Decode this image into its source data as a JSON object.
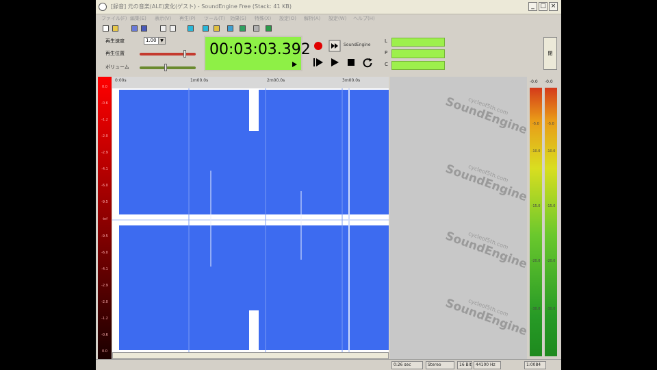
{
  "window": {
    "title": "[録音] 元の音楽(ALE)変化(ゲスト) - SoundEngine Free (Stack: 41 KB)",
    "controls": [
      "_",
      "□",
      "×"
    ]
  },
  "menu": [
    "ファイル(F)",
    "編集(E)",
    "表示(V)",
    "再生(P)",
    "ツール(T)",
    "効果(S)",
    "特殊(X)",
    "設定(O)",
    "解析(A)",
    "設定(W)",
    "ヘルプ(H)"
  ],
  "controls_panel": {
    "speed_label": "再生速度",
    "speed_value": "1.00",
    "position_label": "再生位置",
    "volume_label": "ボリューム"
  },
  "time_display": "00:03:03.392",
  "transport": {
    "brand": "SoundEngine",
    "buttons": [
      "record",
      "record-next",
      "play-selection",
      "play",
      "stop",
      "loop"
    ]
  },
  "mini_labels": [
    "L",
    "P",
    "C"
  ],
  "mini_button": "閉",
  "db_scale": [
    "0.0",
    "-0.6",
    "-1.2",
    "-2.0",
    "-2.9",
    "-4.1",
    "-6.0",
    "-9.5",
    "-inf",
    "-9.5",
    "-6.0",
    "-4.1",
    "-2.9",
    "-2.0",
    "-1.2",
    "-0.6",
    "0.0"
  ],
  "ruler": [
    "0:00s",
    "1m00.0s",
    "2m00.0s",
    "3m00.0s"
  ],
  "watermark": {
    "brand": "SoundEngine",
    "site": "cycleof5th.com"
  },
  "meters": {
    "left_peak": "-0.0",
    "right_peak": "-0.0",
    "scale": [
      "-5.0",
      "-10.0",
      "-15.0",
      "-20.0",
      "-30.0"
    ]
  },
  "status": [
    "0:26 sec",
    "Stereo",
    "16 Bit",
    "44100 Hz",
    "1:0084"
  ],
  "colors": {
    "waveform": "#3d6bf0",
    "time_display_bg": "#8ef046",
    "db_scale_top": "#ff0000",
    "record_button": "#e00000"
  }
}
